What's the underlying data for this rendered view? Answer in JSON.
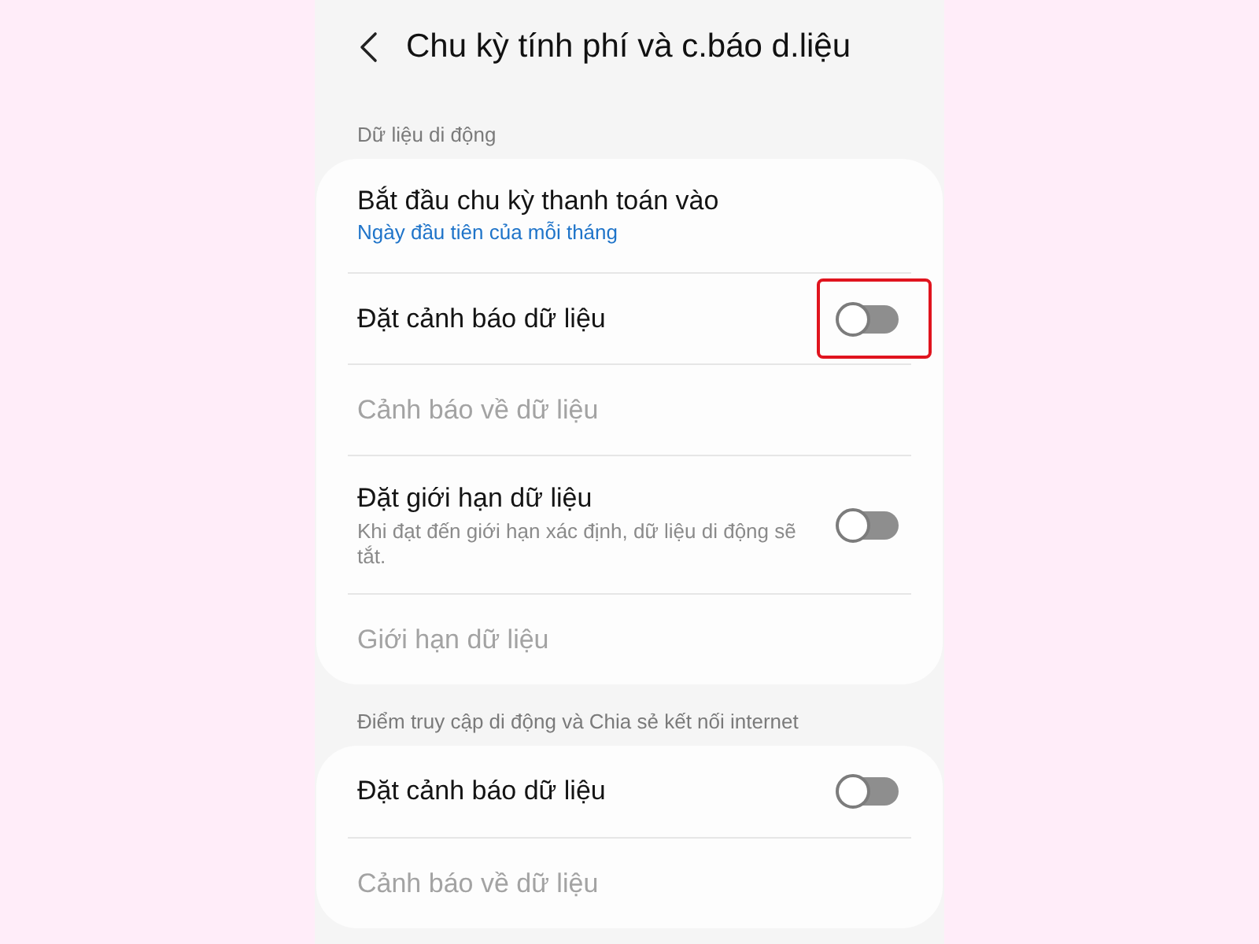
{
  "header": {
    "title": "Chu kỳ tính phí và c.báo d.liệu"
  },
  "sections": [
    {
      "label": "Dữ liệu di động",
      "items": [
        {
          "kind": "link",
          "title": "Bắt đầu chu kỳ thanh toán vào",
          "value": "Ngày đầu tiên của mỗi tháng",
          "disabled": false,
          "highlighted": false
        },
        {
          "kind": "toggle",
          "title": "Đặt cảnh báo dữ liệu",
          "on": false,
          "disabled": false,
          "highlighted": true
        },
        {
          "kind": "link",
          "title": "Cảnh báo về dữ liệu",
          "disabled": true,
          "highlighted": false
        },
        {
          "kind": "toggle",
          "title": "Đặt giới hạn dữ liệu",
          "description": "Khi đạt đến giới hạn xác định, dữ liệu di động sẽ tắt.",
          "on": false,
          "disabled": false,
          "highlighted": false
        },
        {
          "kind": "link",
          "title": "Giới hạn dữ liệu",
          "disabled": true,
          "highlighted": false
        }
      ]
    },
    {
      "label": "Điểm truy cập di động và Chia sẻ kết nối internet",
      "items": [
        {
          "kind": "toggle",
          "title": "Đặt cảnh báo dữ liệu",
          "on": false,
          "disabled": false,
          "highlighted": false
        },
        {
          "kind": "link",
          "title": "Cảnh báo về dữ liệu",
          "disabled": true,
          "highlighted": false
        }
      ]
    }
  ]
}
